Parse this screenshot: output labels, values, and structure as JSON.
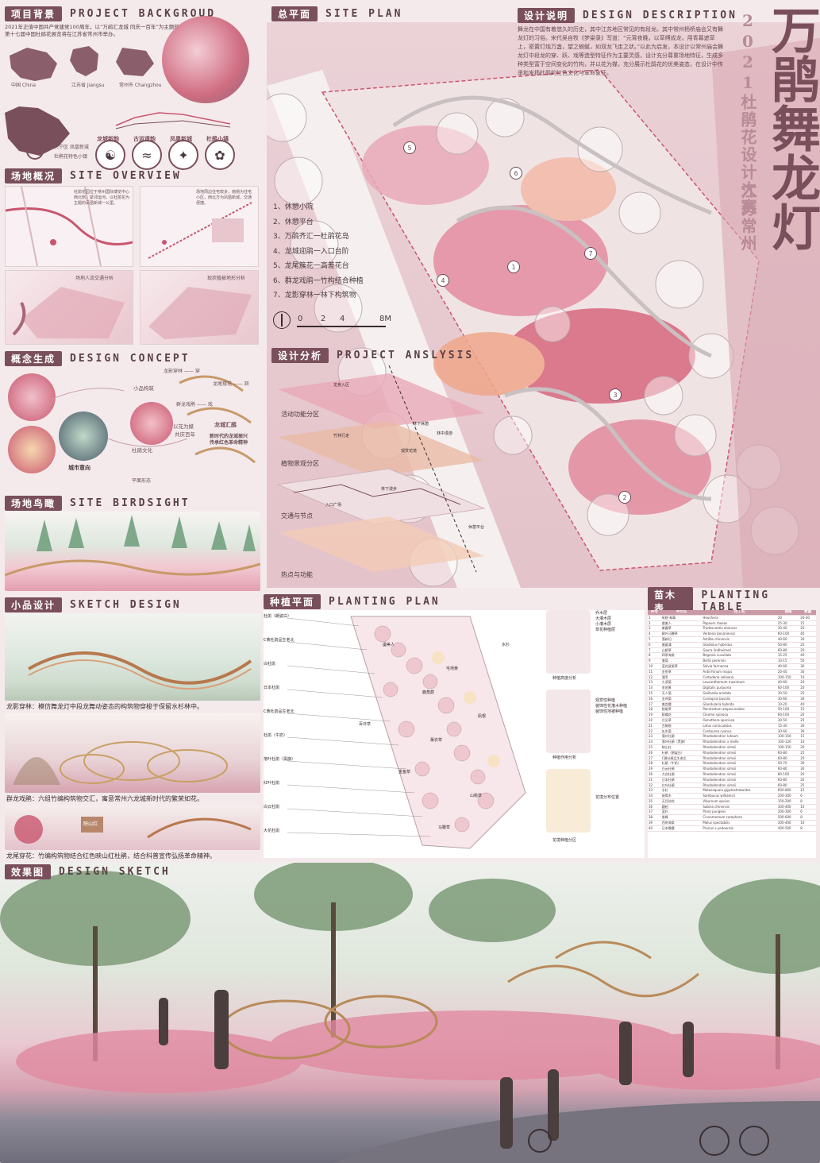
{
  "title": {
    "main": "万鹃舞龙灯",
    "competition": "2021杜鹃花设计大赛",
    "location": "江苏常州"
  },
  "sections": {
    "background": {
      "tag": "项目背景",
      "en": "PROJECT BACKGROUD"
    },
    "overview": {
      "tag": "场地概况",
      "en": "SITE OVERVIEW"
    },
    "concept": {
      "tag": "概念生成",
      "en": "DESIGN CONCEPT"
    },
    "birdsight": {
      "tag": "场地鸟瞰",
      "en": "SITE BIRDSIGHT"
    },
    "sketch": {
      "tag": "小品设计",
      "en": "SKETCH DESIGN"
    },
    "siteplan": {
      "tag": "总平面",
      "en": "SITE PLAN"
    },
    "description": {
      "tag": "设计说明",
      "en": "DESIGN DESCRIPTION"
    },
    "analysis": {
      "tag": "设计分析",
      "en": "PROJECT ANSLYSIS"
    },
    "planting": {
      "tag": "种植平面",
      "en": "PLANTING PLAN"
    },
    "table": {
      "tag": "苗木表",
      "en": "PLANTING TABLE"
    },
    "effect": {
      "tag": "效果图",
      "en": "DESIGN SKETCH"
    }
  },
  "background": {
    "text": "2021年正值中国共产党建党100周年，以“万鹃汇龙城 同庆一百年”为主题的第十七届中国杜鹃花展览将在江苏省常州市举办。",
    "maps": [
      "中国 China",
      "江苏省 Jiangsu",
      "常州市 Changzhou"
    ],
    "site": [
      "天宁区 凤凰新城",
      "杜鹃花特色小镇"
    ],
    "badges": [
      "龙城新韵",
      "古运遗韵",
      "凤凰新城",
      "杜鹃小镇"
    ]
  },
  "overview": {
    "text1": "杜鹃花园位于常州国际博览中心西北侧，紧邻运河，以杜鹃花为主题的凤凰新城一公里。",
    "text2": "场地周边住宅较多，南侧为住宅小区，西北方为凤凰新城，交通便捷。",
    "captions": [
      "场地人流交通分析",
      "现状植被地形分析"
    ]
  },
  "concept": {
    "labels": [
      "龙影穿林 —— 穿",
      "龙尾摆花 —— 跃",
      "群龙戏鹃 —— 戏",
      "龙城汇鹃",
      "新时代的龙城振兴",
      "传承红色革命精神",
      "以花为媒",
      "共庆百年",
      "杜鹃文化",
      "城市意向",
      "平面形态",
      "小品构筑"
    ]
  },
  "legend": {
    "items": [
      "1、休憩小院",
      "2、休憩平台",
      "3、万鹃齐汇一杜鹃花岛",
      "4、龙城迎鹃一入口台阶",
      "5、龙尾簇花一高差花台",
      "6、群龙戏鹃一竹构结合种植",
      "7、龙影穿林一林下构筑物"
    ],
    "scale": [
      "0",
      "2",
      "4",
      "8M"
    ]
  },
  "plan_markers": [
    "1",
    "2",
    "3",
    "4",
    "5",
    "6",
    "7"
  ],
  "description": {
    "text": "舞龙在中国有着悠久的历史，其中江苏地区常见的有段龙。其中常州杨桥庙会又有舞龙灯的习俗。宋代吴自牧《梦粱录》写道：“元宵夜晚，以草缚成龙，用青幕遮草上，密置灯烛万盏，望之蜿蜒，如双龙飞走之状。”以此为启发，本设计以常州庙会舞龙灯中段龙的穿、跃、戏等造型特征作为主要灵感，设计充分尊重场地特征，生成多种类型富于空间变化的竹构，并以花为媒，充分展示杜鹃花的优美姿态，在设计中传承和发扬杜鹃的红色文化与革命象征。"
  },
  "analysis": {
    "layers": [
      "活动功能分区",
      "植物景观分区",
      "交通与节点",
      "热点与功能"
    ],
    "tags": [
      "龙身入区",
      "林下休憩",
      "竹林行走",
      "林下漫步",
      "观赏花境",
      "林中漫游",
      "休憩平台",
      "入口广场"
    ]
  },
  "planting": {
    "left_labels": [
      "杜鹃（朗姿白）",
      "C黄杜鹃品生老北",
      "白杜鹃",
      "日本杜鹃",
      "C黄杜鹃品生老北",
      "杜鹃（牛奶）",
      "落叶杜鹃（黑旗）",
      "红叶杜鹃",
      "白云杜鹃",
      "大花杜鹃"
    ],
    "map_labels": [
      "虞美人",
      "百日草",
      "鹿角蕨",
      "毛地黄",
      "金鱼草",
      "薰衣草",
      "矾根",
      "水杉",
      "山桃草",
      "马鞭草"
    ],
    "analysis_captions": [
      "种植高度分析",
      "种植作用分析",
      "花境种植分区"
    ],
    "legend1": [
      "乔木层",
      "大灌木层",
      "小灌木层",
      "草花种植层"
    ],
    "legend2": [
      "观赏性种植",
      "装饰性花灌木种植",
      "装饰性地被种植"
    ],
    "legend3": [
      "花境分布位置"
    ]
  },
  "plant_table": {
    "headers": [
      "序号",
      "中文名",
      "拉丁名",
      "规格",
      "数量"
    ],
    "rows": [
      [
        "1",
        "矾根·青莓",
        "Heuchera",
        "20",
        "20-30"
      ],
      [
        "2",
        "虞美人",
        "Papaver rhoeas",
        "25-30",
        "15"
      ],
      [
        "3",
        "紫露草",
        "Tradescantia ohiensis",
        "30-40",
        "20"
      ],
      [
        "4",
        "柳叶马鞭草",
        "Verbena bonariensis",
        "60-100",
        "40"
      ],
      [
        "5",
        "落新妇",
        "Astilbe chinensis",
        "40-60",
        "30"
      ],
      [
        "6",
        "唐菖蒲",
        "Gladiolus hybridus",
        "50-80",
        "25"
      ],
      [
        "7",
        "山桃草",
        "Gaura lindheimeri",
        "60-80",
        "20"
      ],
      [
        "8",
        "四季海棠",
        "Begonia cucullata",
        "15-25",
        "40"
      ],
      [
        "9",
        "雏菊",
        "Bellis perennis",
        "10-15",
        "50"
      ],
      [
        "10",
        "蓝花鼠尾草",
        "Salvia farinacea",
        "40-60",
        "30"
      ],
      [
        "11",
        "金鱼草",
        "Antirrhinum majus",
        "20-40",
        "30"
      ],
      [
        "12",
        "蒲苇",
        "Cortaderia selloana",
        "100-150",
        "10"
      ],
      [
        "13",
        "大滨菊",
        "Leucanthemum maximum",
        "40-60",
        "20"
      ],
      [
        "14",
        "毛地黄",
        "Digitalis purpurea",
        "60-100",
        "20"
      ],
      [
        "15",
        "天人菊",
        "Gaillardia aristata",
        "30-50",
        "25"
      ],
      [
        "16",
        "金鸡菊",
        "Coreopsis basalis",
        "30-60",
        "30"
      ],
      [
        "17",
        "美女樱",
        "Glandularia hybrida",
        "10-20",
        "40"
      ],
      [
        "18",
        "狼尾草",
        "Pennisetum alopecuroides",
        "50-100",
        "15"
      ],
      [
        "19",
        "醉蝶花",
        "Cleome spinosa",
        "60-100",
        "20"
      ],
      [
        "20",
        "月见草",
        "Oenothera speciosa",
        "30-50",
        "25"
      ],
      [
        "21",
        "百脉根",
        "Lotus corniculatus",
        "15-30",
        "30"
      ],
      [
        "22",
        "矢车菊",
        "Centaurea cyanus",
        "30-60",
        "30"
      ],
      [
        "23",
        "落叶杜鹃",
        "Rhododendron luteum",
        "100-150",
        "15"
      ],
      [
        "24",
        "落叶杜鹃（黑旗）",
        "Rhododendron x molle",
        "100-120",
        "10"
      ],
      [
        "25",
        "映山红",
        "Rhododendron simsii",
        "100-150",
        "20"
      ],
      [
        "26",
        "杜鹃（朗姿白）",
        "Rhododendron simsii",
        "60-80",
        "25"
      ],
      [
        "27",
        "C黄杜鹃品生老北",
        "Rhododendron simsii",
        "60-80",
        "20"
      ],
      [
        "28",
        "杜鹃（牛奶）",
        "Rhododendron simsii",
        "50-70",
        "30"
      ],
      [
        "29",
        "白云杜鹃",
        "Rhododendron simsii",
        "60-80",
        "30"
      ],
      [
        "30",
        "大花杜鹃",
        "Rhododendron simsii",
        "80-100",
        "20"
      ],
      [
        "31",
        "日本杜鹃",
        "Rhododendron simsii",
        "60-80",
        "20"
      ],
      [
        "32",
        "红叶杜鹃",
        "Rhododendron simsii",
        "60-80",
        "25"
      ],
      [
        "33",
        "水杉",
        "Metasequoia glyptostroboides",
        "600-800",
        "12"
      ],
      [
        "34",
        "接骨木",
        "Sambucus williamsii",
        "200-300",
        "6"
      ],
      [
        "35",
        "天目琼花",
        "Viburnum opulus",
        "150-200",
        "8"
      ],
      [
        "36",
        "圆柏",
        "Sabina chinensis",
        "300-400",
        "10"
      ],
      [
        "37",
        "蓝杉",
        "Picea pungens",
        "200-300",
        "6"
      ],
      [
        "38",
        "香樟",
        "Cinnamomum camphora",
        "500-600",
        "8"
      ],
      [
        "39",
        "西府海棠",
        "Malus spectabilis",
        "300-400",
        "10"
      ],
      [
        "40",
        "日本晚樱",
        "Prunus x yedoensis",
        "400-500",
        "8"
      ]
    ]
  },
  "captions": {
    "sketch1": "龙影穿林：模仿舞龙灯中段龙舞动姿态的构筑物穿梭于保留水杉林中。",
    "sketch2": "群龙戏鹃：六组竹编构筑物交汇，寓意常州六龙城新时代的繁荣如花。",
    "sketch3": "龙尾穿花：竹编构筑物结合红色映山红杜鹃，结合科普宣传弘扬革命精神。",
    "sign": "映山红"
  },
  "colors": {
    "accent": "#7a4f5c",
    "pink": "#e7b7c2",
    "deep_pink": "#c9566f",
    "title": "#7a4f5c",
    "title_alt": "#b98a97"
  }
}
